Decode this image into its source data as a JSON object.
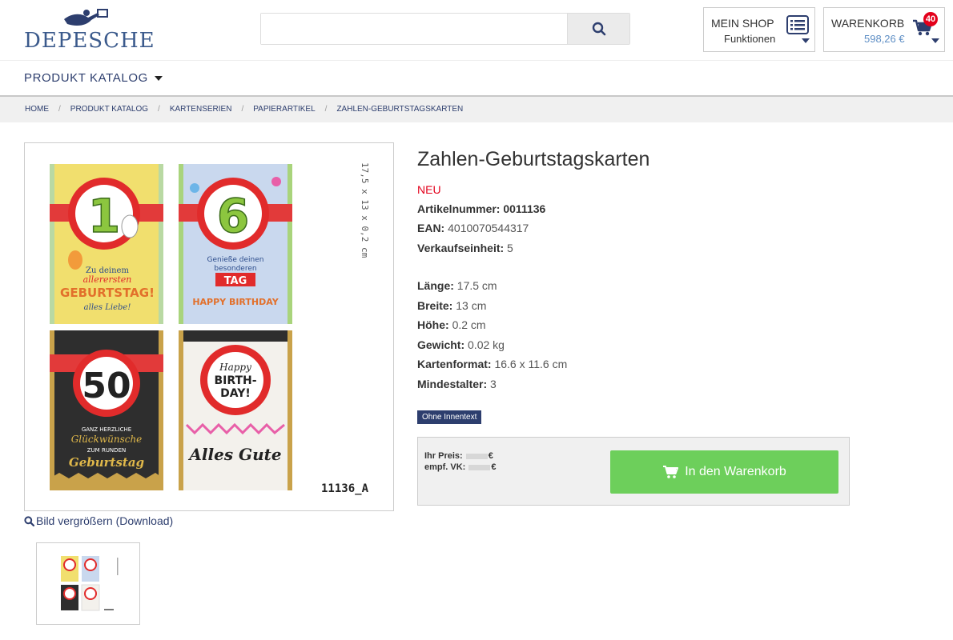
{
  "brand": {
    "name": "DEPESCHE"
  },
  "search": {
    "placeholder": "",
    "value": ""
  },
  "myshop": {
    "title": "MEIN SHOP",
    "subtitle": "Funktionen"
  },
  "cart": {
    "title": "WARENKORB",
    "total": "598,26 €",
    "count": "40"
  },
  "nav": {
    "catalog_label": "PRODUKT KATALOG"
  },
  "breadcrumb": [
    "HOME",
    "PRODUKT KATALOG",
    "KARTENSERIEN",
    "PAPIERARTIKEL",
    "ZAHLEN-GEBURTSTAGSKARTEN"
  ],
  "product": {
    "title": "Zahlen-Geburtstagskarten",
    "badge": "NEU",
    "article_label": "Artikelnummer:",
    "article_number": "0011136",
    "ean_label": "EAN:",
    "ean": "4010070544317",
    "unit_label": "Verkaufseinheit:",
    "unit": "5",
    "specs": [
      {
        "label": "Länge:",
        "value": "17.5 cm"
      },
      {
        "label": "Breite:",
        "value": "13 cm"
      },
      {
        "label": "Höhe:",
        "value": "0.2 cm"
      },
      {
        "label": "Gewicht:",
        "value": "0.02 kg"
      },
      {
        "label": "Kartenformat:",
        "value": "16.6 x 11.6 cm"
      },
      {
        "label": "Mindestalter:",
        "value": "3"
      }
    ],
    "tag": "Ohne Innentext"
  },
  "image": {
    "dimension_label": "17,5 x 13 x 0,2 cm",
    "article_code": "11136_A",
    "zoom_link": "Bild vergrößern (Download)",
    "cards": [
      {
        "number": "1",
        "line1": "Zu deinem",
        "line2": "allerersten",
        "line3": "GEBURTSTAG!",
        "line4": "alles Liebe!"
      },
      {
        "number": "6",
        "line1": "Genieße deinen",
        "line2": "besonderen",
        "line3": "TAG",
        "line4": "HAPPY BIRTHDAY"
      },
      {
        "number": "50",
        "line1": "GANZ HERZLICHE",
        "line2": "Glückwünsche",
        "line3": "ZUM RUNDEN",
        "line4": "Geburtstag"
      },
      {
        "number": "Happy BIRTH-DAY!",
        "line1": "Alles Gute"
      }
    ]
  },
  "price": {
    "our_price_label": "Ihr Preis:",
    "rrp_label": "empf. VK:",
    "currency": "€",
    "button_label": "In den Warenkorb"
  },
  "colors": {
    "brand_blue": "#2d3e6e",
    "accent_red": "#e3001b",
    "cart_green": "#6dcf5b"
  }
}
